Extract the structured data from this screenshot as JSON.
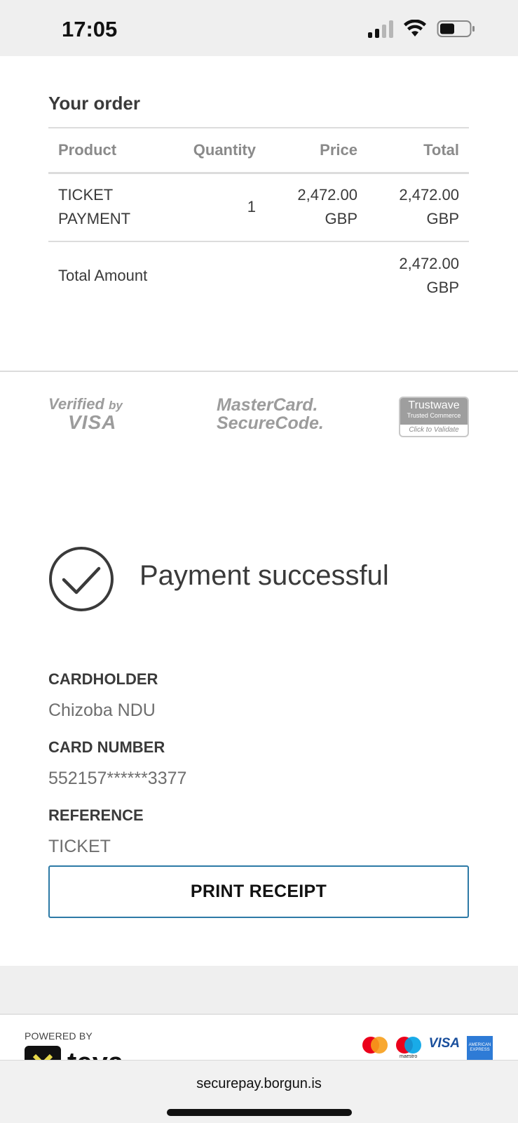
{
  "status_bar": {
    "time": "17:05",
    "icons": [
      "signal-icon",
      "wifi-icon",
      "battery-icon"
    ]
  },
  "order": {
    "title": "Your order",
    "columns": [
      "Product",
      "Quantity",
      "Price",
      "Total"
    ],
    "items": [
      {
        "product": "TICKET PAYMENT",
        "quantity": "1",
        "price": "2,472.00 GBP",
        "total": "2,472.00 GBP"
      }
    ],
    "total_label": "Total Amount",
    "total_value": "2,472.00 GBP"
  },
  "security_badges": {
    "verified_by_visa": {
      "line1": "Verified",
      "by": "by",
      "line2": "VISA"
    },
    "mastercard": {
      "line1": "MasterCard.",
      "line2": "SecureCode."
    },
    "trustwave": {
      "name": "Trustwave",
      "sub": "Trusted Commerce",
      "action": "Click to Validate"
    }
  },
  "payment": {
    "status_text": "Payment successful",
    "cardholder_label": "CARDHOLDER",
    "cardholder_value": "Chizoba NDU",
    "card_number_label": "CARD NUMBER",
    "card_number_value": "552157******3377",
    "reference_label": "REFERENCE",
    "reference_value": "TICKET",
    "print_button": "PRINT RECEIPT"
  },
  "footer": {
    "powered_by": "POWERED BY",
    "brand": "teya",
    "payment_logos": [
      "mastercard-logo",
      "maestro-logo",
      "visa-logo",
      "amex-logo"
    ],
    "maestro_label": "maestro",
    "visa_label": "VISA",
    "amex_label": "AMERICAN EXPRESS"
  },
  "browser": {
    "url": "securepay.borgun.is"
  },
  "colors": {
    "button_border": "#2d7aa6",
    "header_text": "#8a8a8a",
    "body_text": "#3a3a3a",
    "value_text": "#6e6e6e"
  }
}
